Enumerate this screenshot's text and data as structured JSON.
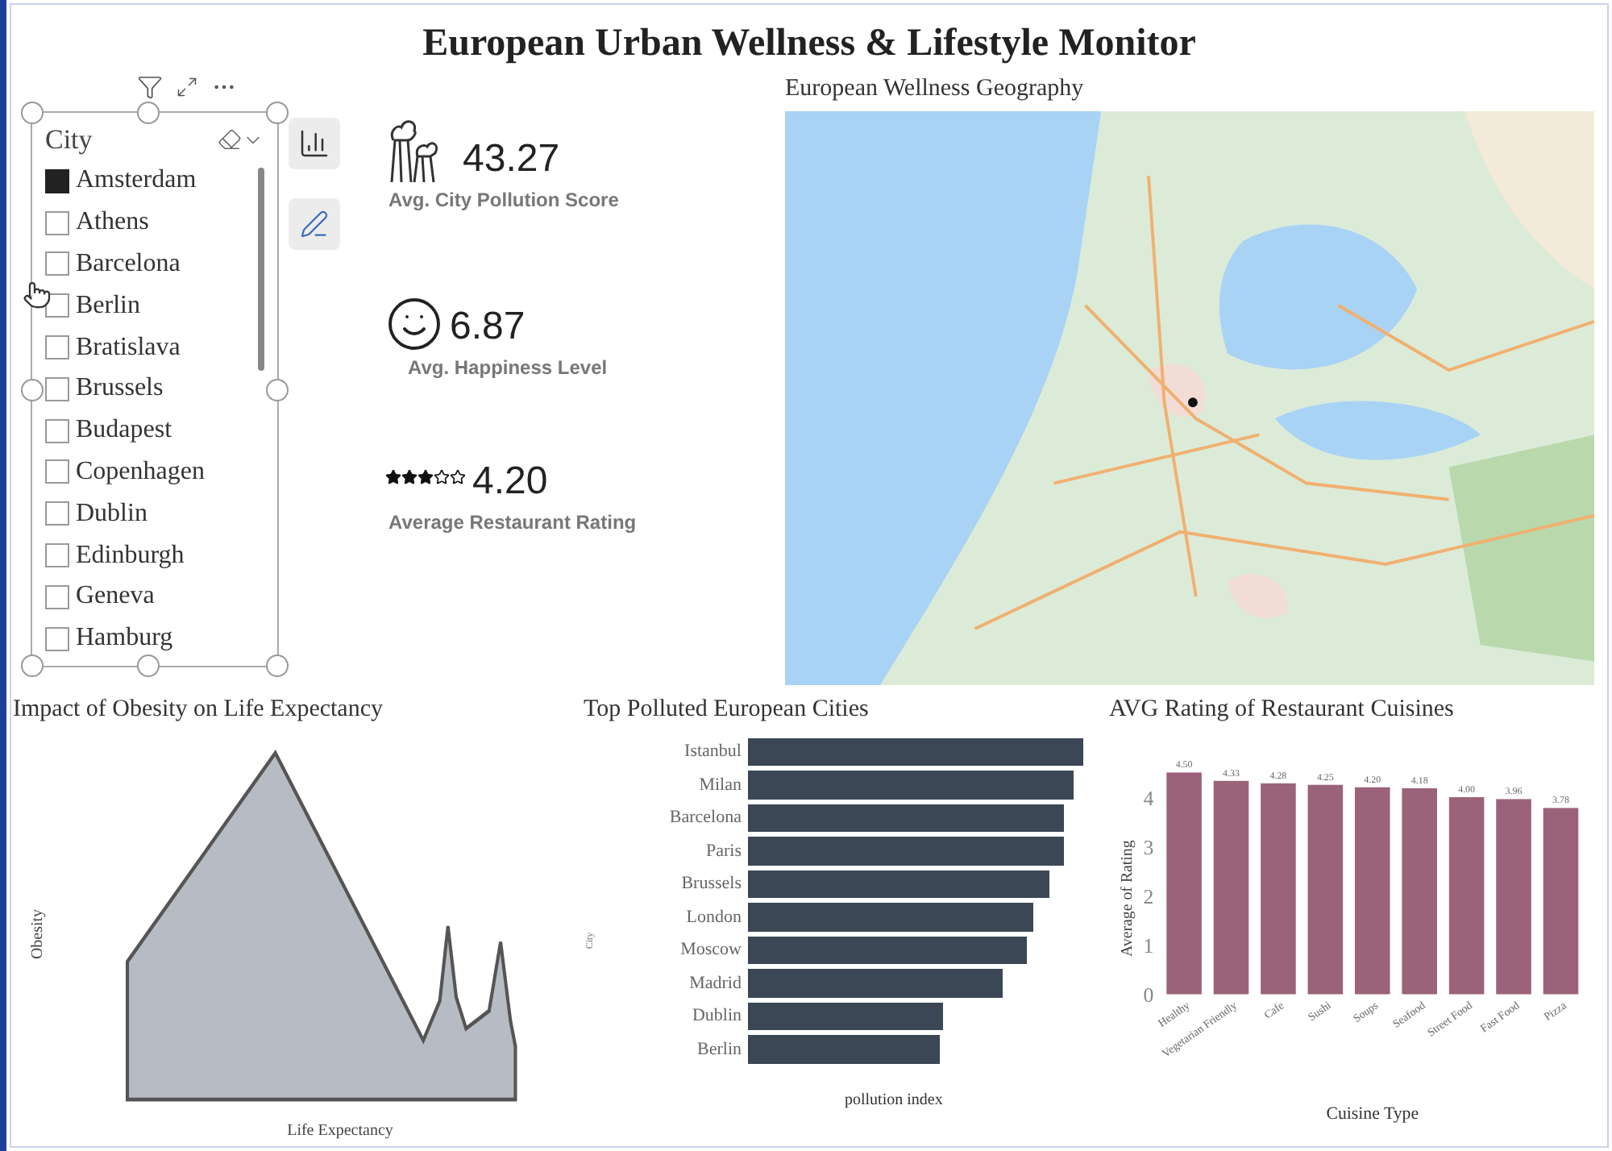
{
  "title": "European Urban Wellness & Lifestyle Monitor",
  "slicer": {
    "title": "City",
    "items": [
      {
        "label": "Amsterdam",
        "checked": true
      },
      {
        "label": "Athens",
        "checked": false
      },
      {
        "label": "Barcelona",
        "checked": false
      },
      {
        "label": "Berlin",
        "checked": false
      },
      {
        "label": "Bratislava",
        "checked": false
      },
      {
        "label": "Brussels",
        "checked": false
      },
      {
        "label": "Budapest",
        "checked": false
      },
      {
        "label": "Copenhagen",
        "checked": false
      },
      {
        "label": "Dublin",
        "checked": false
      },
      {
        "label": "Edinburgh",
        "checked": false
      },
      {
        "label": "Geneva",
        "checked": false
      },
      {
        "label": "Hamburg",
        "checked": false
      }
    ]
  },
  "kpis": [
    {
      "kind": "pollution",
      "value": "43.27",
      "label": "Avg. City Pollution Score"
    },
    {
      "kind": "happiness",
      "value": "6.87",
      "label": "Avg. Happiness Level"
    },
    {
      "kind": "rating",
      "value": "4.20",
      "label": "Average Restaurant Rating",
      "stars": 3
    }
  ],
  "map": {
    "title": "European Wellness Geography",
    "kind": "picture"
  },
  "obesity_chart": {
    "title": "Impact of Obesity on Life Expectancy",
    "xlabel": "Life Expectancy",
    "ylabel": "Obesity"
  },
  "pollution_chart": {
    "title": "Top Polluted European Cities",
    "xlabel": "pollution index",
    "ylabel": "City",
    "categories": [
      "Istanbul",
      "Milan",
      "Barcelona",
      "Paris",
      "Brussels",
      "London",
      "Moscow",
      "Madrid",
      "Dublin",
      "Berlin"
    ]
  },
  "cuisine_chart": {
    "chart_data": {
      "type": "bar",
      "title": "AVG Rating of Restaurant Cuisines",
      "xlabel": "Cuisine Type",
      "ylabel": "Average of Rating",
      "categories": [
        "Healthy",
        "Vegetarian Friendly",
        "Cafe",
        "Sushi",
        "Soups",
        "Seafood",
        "Street Food",
        "Fast Food",
        "Pizza"
      ],
      "series": [
        {
          "color": "#9b6379",
          "values": [
            4.5,
            4.33,
            4.28,
            4.25,
            4.2,
            4.18,
            4.0,
            3.96,
            3.78
          ]
        }
      ],
      "ylim": [
        0,
        4.6
      ],
      "yticks": [
        0,
        1,
        2,
        3,
        4
      ],
      "value_labels": [
        "4.50",
        "4.33",
        "4.28",
        "4.25",
        "4.20",
        "4.18",
        "4.00",
        "3.96",
        "3.78"
      ]
    }
  }
}
